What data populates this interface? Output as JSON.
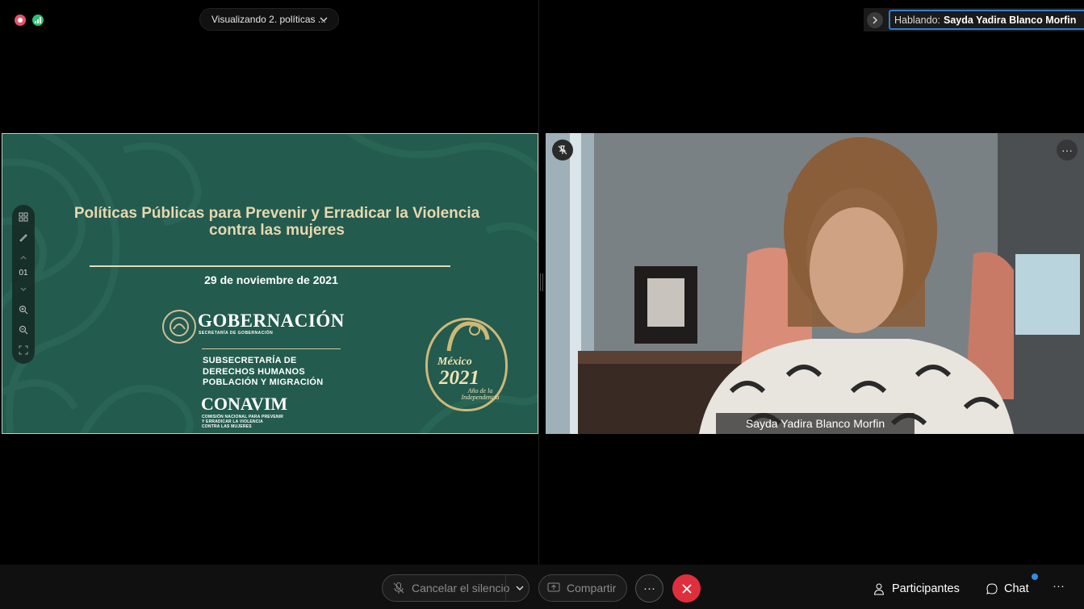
{
  "top_bar": {
    "viewing_label": "Visualizando 2. políticas ...",
    "speaking_prefix": "Hablando:",
    "speaking_name": "Sayda Yadira Blanco Morfin"
  },
  "slide": {
    "title": "Políticas Públicas para Prevenir y Erradicar la Violencia contra las mujeres",
    "date": "29 de noviembre de 2021",
    "gob_name": "GOBERNACIÓN",
    "gob_sub": "SECRETARÍA DE GOBERNACIÓN",
    "subsec_line1": "SUBSECRETARÍA DE",
    "subsec_line2": "DERECHOS HUMANOS",
    "subsec_line3": "POBLACIÓN Y MIGRACIÓN",
    "conavim": "CONAVIM",
    "conavim_sub1": "COMISIÓN NACIONAL PARA PREVENIR",
    "conavim_sub2": "Y ERRADICAR LA VIOLENCIA",
    "conavim_sub3": "CONTRA LAS MUJERES",
    "badge_line1": "México",
    "badge_line2": "2021",
    "badge_line3": "Año de la Independencia",
    "page_number": "01"
  },
  "video": {
    "participant_name": "Sayda Yadira Blanco Morfin",
    "more_label": "···"
  },
  "bottom_bar": {
    "mute_label": "Cancelar el silencio",
    "share_label": "Compartir",
    "more_label": "···",
    "participants_label": "Participantes",
    "chat_label": "Chat",
    "overflow_label": "···"
  },
  "colors": {
    "slide_green": "#235b4e",
    "slide_gold": "#e8d7b0",
    "leave_red": "#e02f3c",
    "speaking_border": "#2f7fd1"
  }
}
